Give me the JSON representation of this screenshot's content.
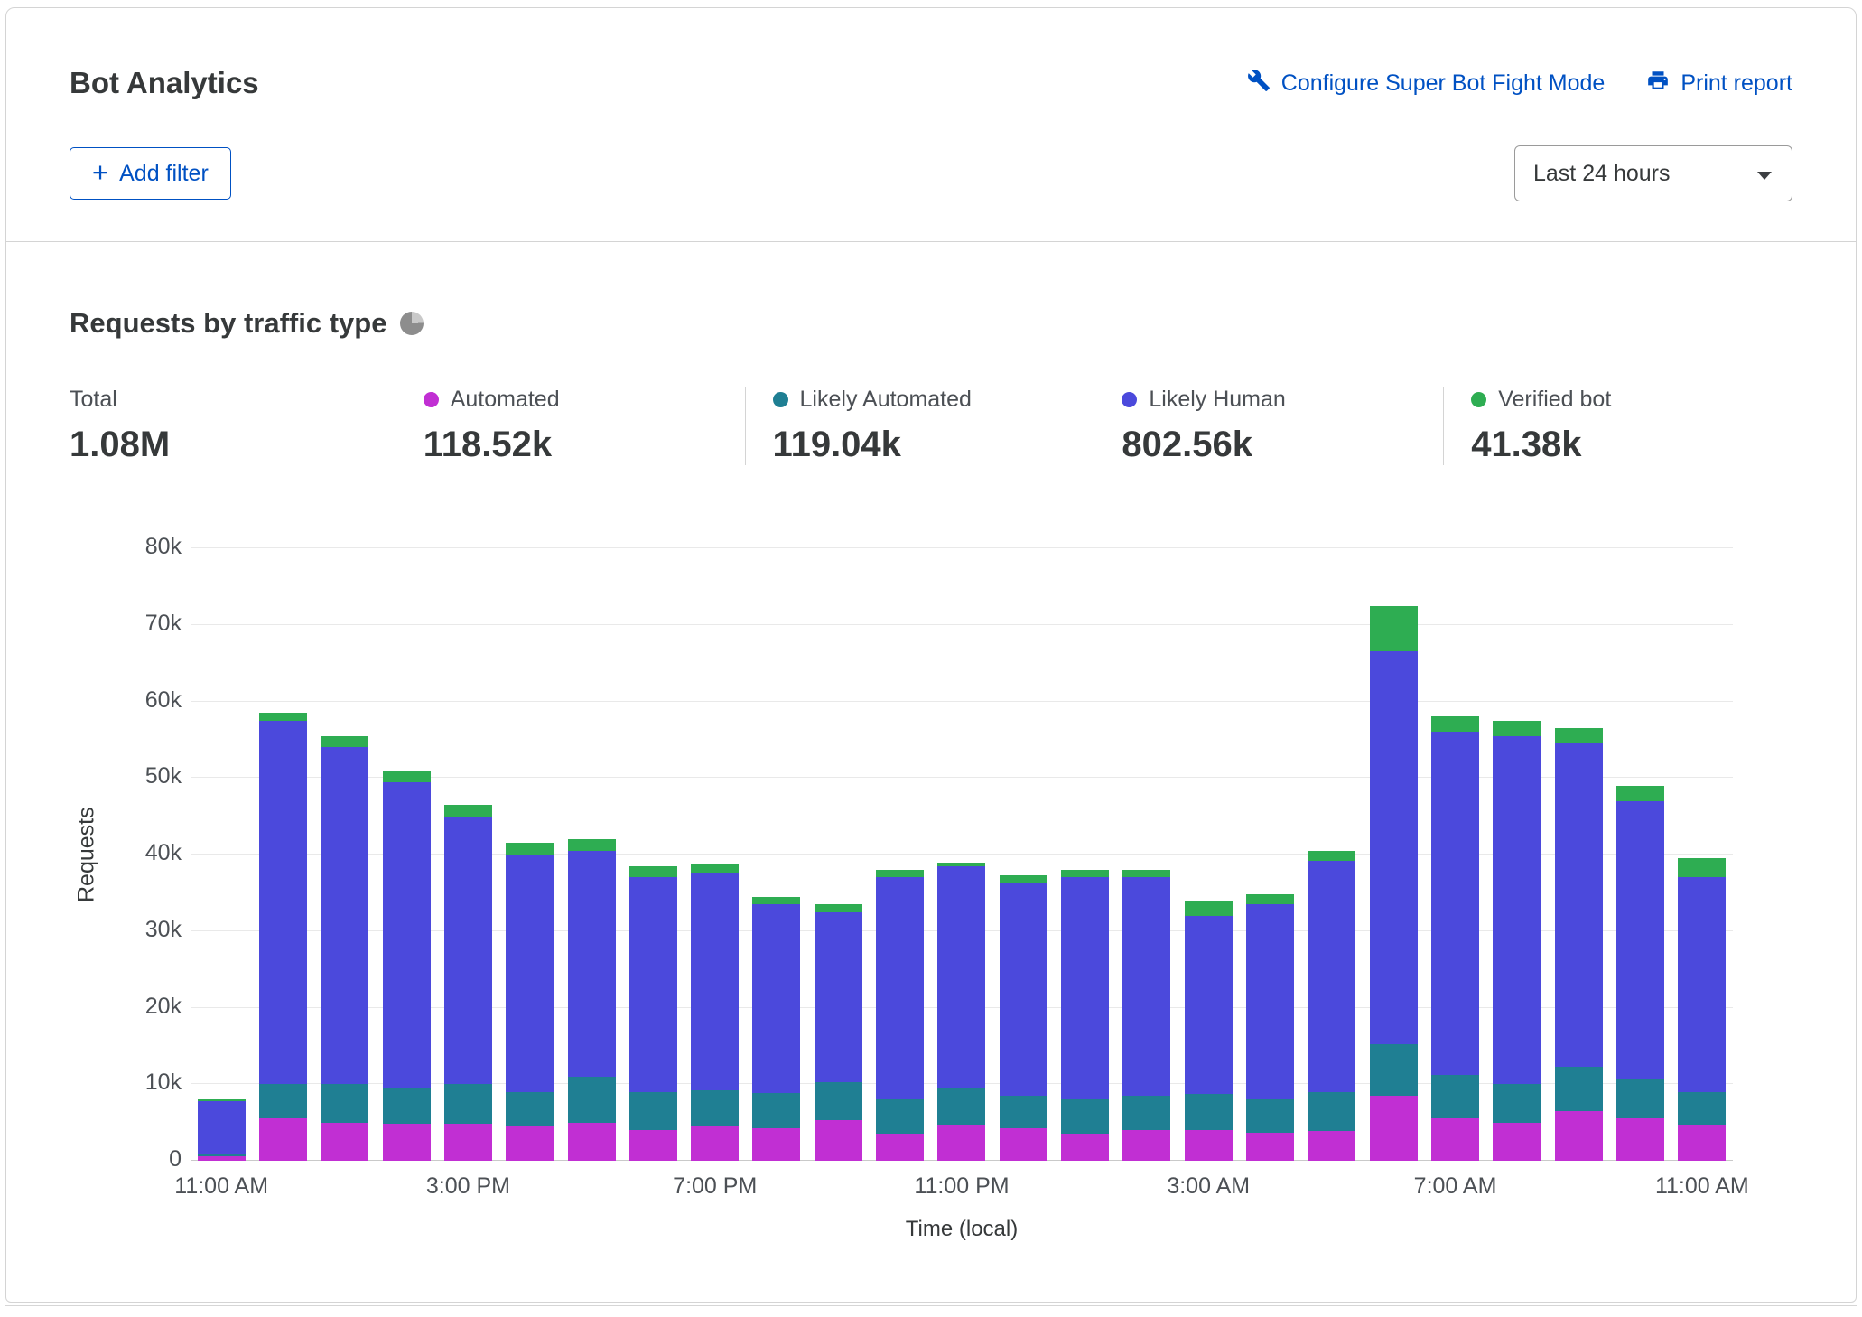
{
  "header": {
    "title": "Bot Analytics",
    "links": {
      "configure": "Configure Super Bot Fight Mode",
      "print": "Print report"
    },
    "add_filter_label": "Add filter",
    "time_range_value": "Last 24 hours"
  },
  "icons": {
    "configure": "wrench-icon",
    "print": "printer-icon",
    "time_range": "chevron-down-icon",
    "section": "pie-chart-icon",
    "add_filter": "plus-icon"
  },
  "section": {
    "title": "Requests by traffic type"
  },
  "stats": [
    {
      "label": "Total",
      "value": "1.08M"
    },
    {
      "label": "Automated",
      "value": "118.52k",
      "color": "#C12FD3"
    },
    {
      "label": "Likely Automated",
      "value": "119.04k",
      "color": "#1F7F93"
    },
    {
      "label": "Likely Human",
      "value": "802.56k",
      "color": "#4B49DC"
    },
    {
      "label": "Verified bot",
      "value": "41.38k",
      "color": "#2EAD52"
    }
  ],
  "chart_data": {
    "type": "bar",
    "stacked": true,
    "title": "Requests by traffic type",
    "xlabel": "Time (local)",
    "ylabel": "Requests",
    "ylim": [
      0,
      80000
    ],
    "grid": true,
    "y_ticks": [
      "0",
      "10k",
      "20k",
      "30k",
      "40k",
      "50k",
      "60k",
      "70k",
      "80k"
    ],
    "x_tick_labels": [
      "11:00 AM",
      "3:00 PM",
      "7:00 PM",
      "11:00 PM",
      "3:00 AM",
      "7:00 AM",
      "11:00 AM"
    ],
    "x_tick_indices": [
      0,
      4,
      8,
      12,
      16,
      20,
      24
    ],
    "series": [
      {
        "key": "automated",
        "name": "Automated",
        "color": "#C12FD3",
        "values": [
          600,
          5500,
          5000,
          4800,
          4800,
          4500,
          5000,
          4000,
          4500,
          4300,
          5300,
          3500,
          4700,
          4200,
          3500,
          4000,
          4000,
          3700,
          3900,
          8500,
          5500,
          5000,
          6500,
          5500,
          4700
        ]
      },
      {
        "key": "likely-automated",
        "name": "Likely Automated",
        "color": "#1F7F93",
        "values": [
          400,
          4500,
          5000,
          4700,
          5200,
          4500,
          6000,
          5000,
          4700,
          4500,
          5000,
          4500,
          4800,
          4300,
          4500,
          4500,
          4700,
          4300,
          5100,
          6700,
          5700,
          5000,
          5800,
          5200,
          4300
        ]
      },
      {
        "key": "likely-human",
        "name": "Likely Human",
        "color": "#4B49DC",
        "values": [
          6800,
          47500,
          44000,
          40000,
          35000,
          31000,
          29500,
          28000,
          28300,
          24700,
          22200,
          29000,
          29000,
          27800,
          29000,
          28500,
          23300,
          25500,
          30200,
          51300,
          44800,
          45500,
          42200,
          36300,
          28000
        ]
      },
      {
        "key": "verified-bot",
        "name": "Verified bot",
        "color": "#2EAD52",
        "values": [
          200,
          1000,
          1500,
          1500,
          1500,
          1500,
          1500,
          1500,
          1200,
          1000,
          1000,
          1000,
          500,
          1000,
          1000,
          1000,
          2000,
          1300,
          1300,
          6000,
          2000,
          2000,
          2000,
          2000,
          2500
        ]
      }
    ]
  }
}
